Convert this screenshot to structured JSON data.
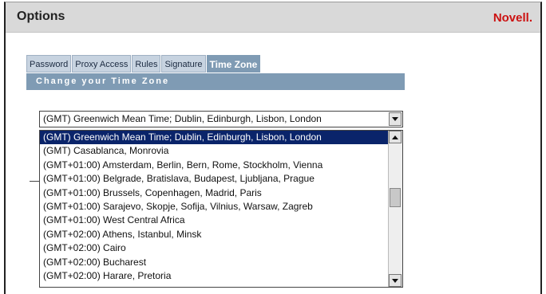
{
  "header": {
    "title": "Options",
    "brand": "Novell."
  },
  "tabs": [
    {
      "label": "Password"
    },
    {
      "label": "Proxy Access"
    },
    {
      "label": "Rules"
    },
    {
      "label": "Signature"
    },
    {
      "label": "Time Zone"
    }
  ],
  "section": {
    "title": "Change your Time Zone"
  },
  "timezone_select": {
    "value": "(GMT) Greenwich Mean Time; Dublin, Edinburgh, Lisbon, London",
    "options": [
      "(GMT) Greenwich Mean Time; Dublin, Edinburgh, Lisbon, London",
      "(GMT) Casablanca, Monrovia",
      "(GMT+01:00) Amsterdam, Berlin, Bern, Rome, Stockholm, Vienna",
      "(GMT+01:00) Belgrade, Bratislava, Budapest, Ljubljana, Prague",
      "(GMT+01:00) Brussels, Copenhagen, Madrid, Paris",
      "(GMT+01:00) Sarajevo, Skopje, Sofija, Vilnius, Warsaw, Zagreb",
      "(GMT+01:00) West Central Africa",
      "(GMT+02:00) Athens, Istanbul, Minsk",
      "(GMT+02:00) Cairo",
      "(GMT+02:00) Bucharest",
      "(GMT+02:00) Harare, Pretoria"
    ]
  },
  "colors": {
    "header_bg": "#d9d9d9",
    "brand": "#cc1111",
    "tab_active": "#7f9bb4",
    "selected_option": "#0a246a"
  }
}
